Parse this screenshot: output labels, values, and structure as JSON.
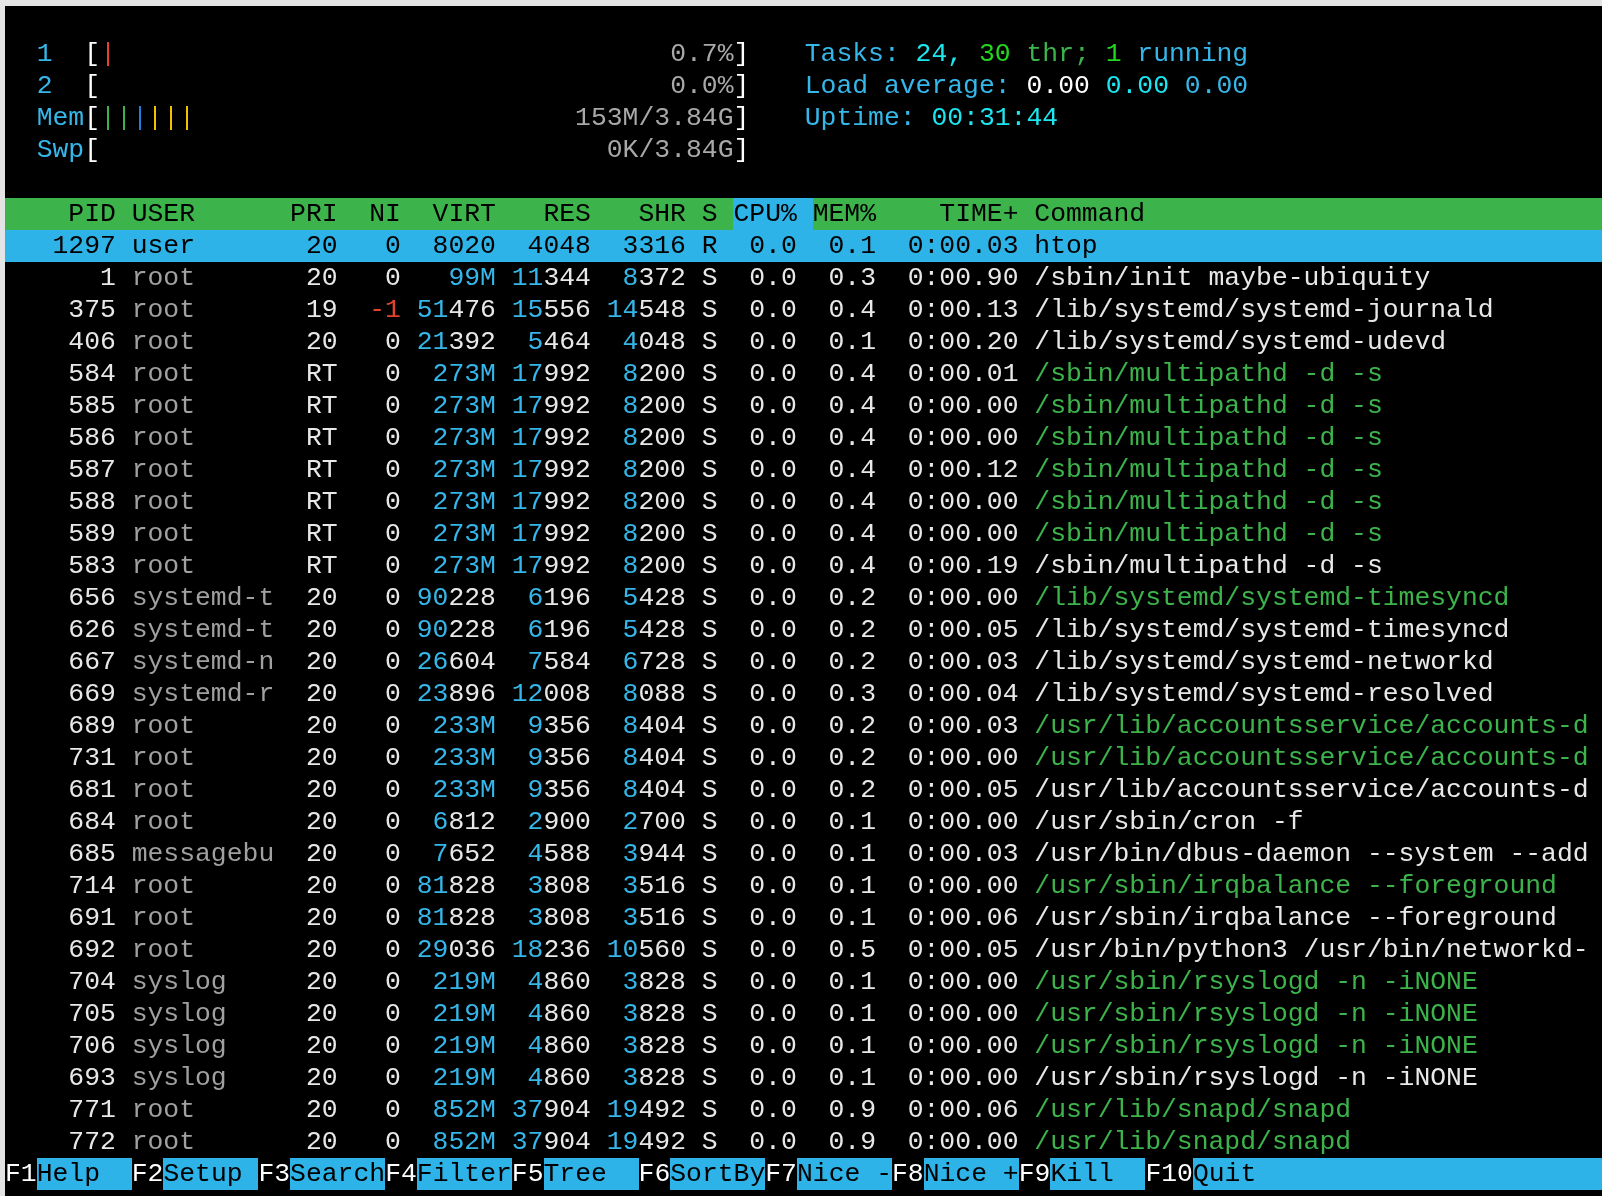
{
  "meters": [
    {
      "label": "1",
      "open": "[",
      "bars": [
        {
          "color": "#e5412f"
        }
      ],
      "value": "0.7%",
      "close": "]"
    },
    {
      "label": "2",
      "open": "[",
      "value": "0.0%",
      "close": "]"
    },
    {
      "label": "Mem",
      "open": "[",
      "bars": [
        {
          "color": "#3cb44b"
        },
        {
          "color": "#3cb44b"
        },
        {
          "color": "#1e7fd8"
        },
        {
          "color": "#f2c200"
        },
        {
          "color": "#f2c200"
        },
        {
          "color": "#f2c200"
        }
      ],
      "value": "153M/3.84G",
      "close": "]"
    },
    {
      "label": "Swp",
      "open": "[",
      "value": "0K/3.84G",
      "close": "]"
    }
  ],
  "summary": [
    {
      "parts": [
        {
          "text": "Tasks:",
          "kind": "label"
        },
        {
          "text": "24,",
          "kind": "value"
        },
        {
          "text": "30",
          "kind": "bright"
        },
        {
          "text": "thr;",
          "kind": "thread"
        },
        {
          "text": "1",
          "kind": "bright"
        },
        {
          "text": "running",
          "kind": "label"
        }
      ]
    },
    {
      "parts": [
        {
          "text": "Load average:",
          "kind": "label"
        },
        {
          "text": "0.00",
          "kind": "strong"
        },
        {
          "text": "0.00",
          "kind": "value"
        },
        {
          "text": "0.00",
          "kind": "label"
        }
      ]
    },
    {
      "parts": [
        {
          "text": "Uptime:",
          "kind": "label"
        },
        {
          "text": "00:31:44",
          "kind": "value"
        }
      ]
    }
  ],
  "columns": [
    {
      "label": "PID",
      "selected": false
    },
    {
      "label": "USER",
      "selected": false
    },
    {
      "label": "PRI",
      "selected": false
    },
    {
      "label": "NI",
      "selected": false
    },
    {
      "label": "VIRT",
      "selected": false
    },
    {
      "label": "RES",
      "selected": false
    },
    {
      "label": "SHR",
      "selected": false
    },
    {
      "label": "S",
      "selected": false
    },
    {
      "label": "CPU%",
      "selected": true
    },
    {
      "label": "MEM%",
      "selected": false
    },
    {
      "label": "TIME+",
      "selected": false
    },
    {
      "label": "Command",
      "selected": false
    }
  ],
  "processes": [
    {
      "pid": "1297",
      "user": "user",
      "pri": "20",
      "ni": "0",
      "virt": "8020",
      "res": "4048",
      "shr": "3316",
      "state": "R",
      "cpu": "0.0",
      "mem": "0.1",
      "time": "0:00.03",
      "command": "htop",
      "selected": true,
      "thread": false
    },
    {
      "pid": "1",
      "user": "root",
      "pri": "20",
      "ni": "0",
      "virt": "99M",
      "res": "11344",
      "shr": "8372",
      "state": "S",
      "cpu": "0.0",
      "mem": "0.3",
      "time": "0:00.90",
      "command": "/sbin/init maybe-ubiquity",
      "selected": false,
      "thread": false
    },
    {
      "pid": "375",
      "user": "root",
      "pri": "19",
      "ni": "-1",
      "virt": "51476",
      "res": "15556",
      "shr": "14548",
      "state": "S",
      "cpu": "0.0",
      "mem": "0.4",
      "time": "0:00.13",
      "command": "/lib/systemd/systemd-journald",
      "selected": false,
      "thread": false
    },
    {
      "pid": "406",
      "user": "root",
      "pri": "20",
      "ni": "0",
      "virt": "21392",
      "res": "5464",
      "shr": "4048",
      "state": "S",
      "cpu": "0.0",
      "mem": "0.1",
      "time": "0:00.20",
      "command": "/lib/systemd/systemd-udevd",
      "selected": false,
      "thread": false
    },
    {
      "pid": "584",
      "user": "root",
      "pri": "RT",
      "ni": "0",
      "virt": "273M",
      "res": "17992",
      "shr": "8200",
      "state": "S",
      "cpu": "0.0",
      "mem": "0.4",
      "time": "0:00.01",
      "command": "/sbin/multipathd -d -s",
      "selected": false,
      "thread": true
    },
    {
      "pid": "585",
      "user": "root",
      "pri": "RT",
      "ni": "0",
      "virt": "273M",
      "res": "17992",
      "shr": "8200",
      "state": "S",
      "cpu": "0.0",
      "mem": "0.4",
      "time": "0:00.00",
      "command": "/sbin/multipathd -d -s",
      "selected": false,
      "thread": true
    },
    {
      "pid": "586",
      "user": "root",
      "pri": "RT",
      "ni": "0",
      "virt": "273M",
      "res": "17992",
      "shr": "8200",
      "state": "S",
      "cpu": "0.0",
      "mem": "0.4",
      "time": "0:00.00",
      "command": "/sbin/multipathd -d -s",
      "selected": false,
      "thread": true
    },
    {
      "pid": "587",
      "user": "root",
      "pri": "RT",
      "ni": "0",
      "virt": "273M",
      "res": "17992",
      "shr": "8200",
      "state": "S",
      "cpu": "0.0",
      "mem": "0.4",
      "time": "0:00.12",
      "command": "/sbin/multipathd -d -s",
      "selected": false,
      "thread": true
    },
    {
      "pid": "588",
      "user": "root",
      "pri": "RT",
      "ni": "0",
      "virt": "273M",
      "res": "17992",
      "shr": "8200",
      "state": "S",
      "cpu": "0.0",
      "mem": "0.4",
      "time": "0:00.00",
      "command": "/sbin/multipathd -d -s",
      "selected": false,
      "thread": true
    },
    {
      "pid": "589",
      "user": "root",
      "pri": "RT",
      "ni": "0",
      "virt": "273M",
      "res": "17992",
      "shr": "8200",
      "state": "S",
      "cpu": "0.0",
      "mem": "0.4",
      "time": "0:00.00",
      "command": "/sbin/multipathd -d -s",
      "selected": false,
      "thread": true
    },
    {
      "pid": "583",
      "user": "root",
      "pri": "RT",
      "ni": "0",
      "virt": "273M",
      "res": "17992",
      "shr": "8200",
      "state": "S",
      "cpu": "0.0",
      "mem": "0.4",
      "time": "0:00.19",
      "command": "/sbin/multipathd -d -s",
      "selected": false,
      "thread": false
    },
    {
      "pid": "656",
      "user": "systemd-t",
      "pri": "20",
      "ni": "0",
      "virt": "90228",
      "res": "6196",
      "shr": "5428",
      "state": "S",
      "cpu": "0.0",
      "mem": "0.2",
      "time": "0:00.00",
      "command": "/lib/systemd/systemd-timesyncd",
      "selected": false,
      "thread": true
    },
    {
      "pid": "626",
      "user": "systemd-t",
      "pri": "20",
      "ni": "0",
      "virt": "90228",
      "res": "6196",
      "shr": "5428",
      "state": "S",
      "cpu": "0.0",
      "mem": "0.2",
      "time": "0:00.05",
      "command": "/lib/systemd/systemd-timesyncd",
      "selected": false,
      "thread": false
    },
    {
      "pid": "667",
      "user": "systemd-n",
      "pri": "20",
      "ni": "0",
      "virt": "26604",
      "res": "7584",
      "shr": "6728",
      "state": "S",
      "cpu": "0.0",
      "mem": "0.2",
      "time": "0:00.03",
      "command": "/lib/systemd/systemd-networkd",
      "selected": false,
      "thread": false
    },
    {
      "pid": "669",
      "user": "systemd-r",
      "pri": "20",
      "ni": "0",
      "virt": "23896",
      "res": "12008",
      "shr": "8088",
      "state": "S",
      "cpu": "0.0",
      "mem": "0.3",
      "time": "0:00.04",
      "command": "/lib/systemd/systemd-resolved",
      "selected": false,
      "thread": false
    },
    {
      "pid": "689",
      "user": "root",
      "pri": "20",
      "ni": "0",
      "virt": "233M",
      "res": "9356",
      "shr": "8404",
      "state": "S",
      "cpu": "0.0",
      "mem": "0.2",
      "time": "0:00.03",
      "command": "/usr/lib/accountsservice/accounts-d",
      "selected": false,
      "thread": true
    },
    {
      "pid": "731",
      "user": "root",
      "pri": "20",
      "ni": "0",
      "virt": "233M",
      "res": "9356",
      "shr": "8404",
      "state": "S",
      "cpu": "0.0",
      "mem": "0.2",
      "time": "0:00.00",
      "command": "/usr/lib/accountsservice/accounts-d",
      "selected": false,
      "thread": true
    },
    {
      "pid": "681",
      "user": "root",
      "pri": "20",
      "ni": "0",
      "virt": "233M",
      "res": "9356",
      "shr": "8404",
      "state": "S",
      "cpu": "0.0",
      "mem": "0.2",
      "time": "0:00.05",
      "command": "/usr/lib/accountsservice/accounts-d",
      "selected": false,
      "thread": false
    },
    {
      "pid": "684",
      "user": "root",
      "pri": "20",
      "ni": "0",
      "virt": "6812",
      "res": "2900",
      "shr": "2700",
      "state": "S",
      "cpu": "0.0",
      "mem": "0.1",
      "time": "0:00.00",
      "command": "/usr/sbin/cron -f",
      "selected": false,
      "thread": false
    },
    {
      "pid": "685",
      "user": "messagebu",
      "pri": "20",
      "ni": "0",
      "virt": "7652",
      "res": "4588",
      "shr": "3944",
      "state": "S",
      "cpu": "0.0",
      "mem": "0.1",
      "time": "0:00.03",
      "command": "/usr/bin/dbus-daemon --system --add",
      "selected": false,
      "thread": false
    },
    {
      "pid": "714",
      "user": "root",
      "pri": "20",
      "ni": "0",
      "virt": "81828",
      "res": "3808",
      "shr": "3516",
      "state": "S",
      "cpu": "0.0",
      "mem": "0.1",
      "time": "0:00.00",
      "command": "/usr/sbin/irqbalance --foreground",
      "selected": false,
      "thread": true
    },
    {
      "pid": "691",
      "user": "root",
      "pri": "20",
      "ni": "0",
      "virt": "81828",
      "res": "3808",
      "shr": "3516",
      "state": "S",
      "cpu": "0.0",
      "mem": "0.1",
      "time": "0:00.06",
      "command": "/usr/sbin/irqbalance --foreground",
      "selected": false,
      "thread": false
    },
    {
      "pid": "692",
      "user": "root",
      "pri": "20",
      "ni": "0",
      "virt": "29036",
      "res": "18236",
      "shr": "10560",
      "state": "S",
      "cpu": "0.0",
      "mem": "0.5",
      "time": "0:00.05",
      "command": "/usr/bin/python3 /usr/bin/networkd-",
      "selected": false,
      "thread": false
    },
    {
      "pid": "704",
      "user": "syslog",
      "pri": "20",
      "ni": "0",
      "virt": "219M",
      "res": "4860",
      "shr": "3828",
      "state": "S",
      "cpu": "0.0",
      "mem": "0.1",
      "time": "0:00.00",
      "command": "/usr/sbin/rsyslogd -n -iNONE",
      "selected": false,
      "thread": true
    },
    {
      "pid": "705",
      "user": "syslog",
      "pri": "20",
      "ni": "0",
      "virt": "219M",
      "res": "4860",
      "shr": "3828",
      "state": "S",
      "cpu": "0.0",
      "mem": "0.1",
      "time": "0:00.00",
      "command": "/usr/sbin/rsyslogd -n -iNONE",
      "selected": false,
      "thread": true
    },
    {
      "pid": "706",
      "user": "syslog",
      "pri": "20",
      "ni": "0",
      "virt": "219M",
      "res": "4860",
      "shr": "3828",
      "state": "S",
      "cpu": "0.0",
      "mem": "0.1",
      "time": "0:00.00",
      "command": "/usr/sbin/rsyslogd -n -iNONE",
      "selected": false,
      "thread": true
    },
    {
      "pid": "693",
      "user": "syslog",
      "pri": "20",
      "ni": "0",
      "virt": "219M",
      "res": "4860",
      "shr": "3828",
      "state": "S",
      "cpu": "0.0",
      "mem": "0.1",
      "time": "0:00.00",
      "command": "/usr/sbin/rsyslogd -n -iNONE",
      "selected": false,
      "thread": false
    },
    {
      "pid": "771",
      "user": "root",
      "pri": "20",
      "ni": "0",
      "virt": "852M",
      "res": "37904",
      "shr": "19492",
      "state": "S",
      "cpu": "0.0",
      "mem": "0.9",
      "time": "0:00.06",
      "command": "/usr/lib/snapd/snapd",
      "selected": false,
      "thread": true
    },
    {
      "pid": "772",
      "user": "root",
      "pri": "20",
      "ni": "0",
      "virt": "852M",
      "res": "37904",
      "shr": "19492",
      "state": "S",
      "cpu": "0.0",
      "mem": "0.9",
      "time": "0:00.00",
      "command": "/usr/lib/snapd/snapd",
      "selected": false,
      "thread": true
    }
  ],
  "function_keys": [
    {
      "key": "F1",
      "label": "Help"
    },
    {
      "key": "F2",
      "label": "Setup"
    },
    {
      "key": "F3",
      "label": "Search"
    },
    {
      "key": "F4",
      "label": "Filter"
    },
    {
      "key": "F5",
      "label": "Tree"
    },
    {
      "key": "F6",
      "label": "SortBy"
    },
    {
      "key": "F7",
      "label": "Nice -"
    },
    {
      "key": "F8",
      "label": "Nice +"
    },
    {
      "key": "F9",
      "label": "Kill"
    },
    {
      "key": "F10",
      "label": "Quit"
    }
  ]
}
